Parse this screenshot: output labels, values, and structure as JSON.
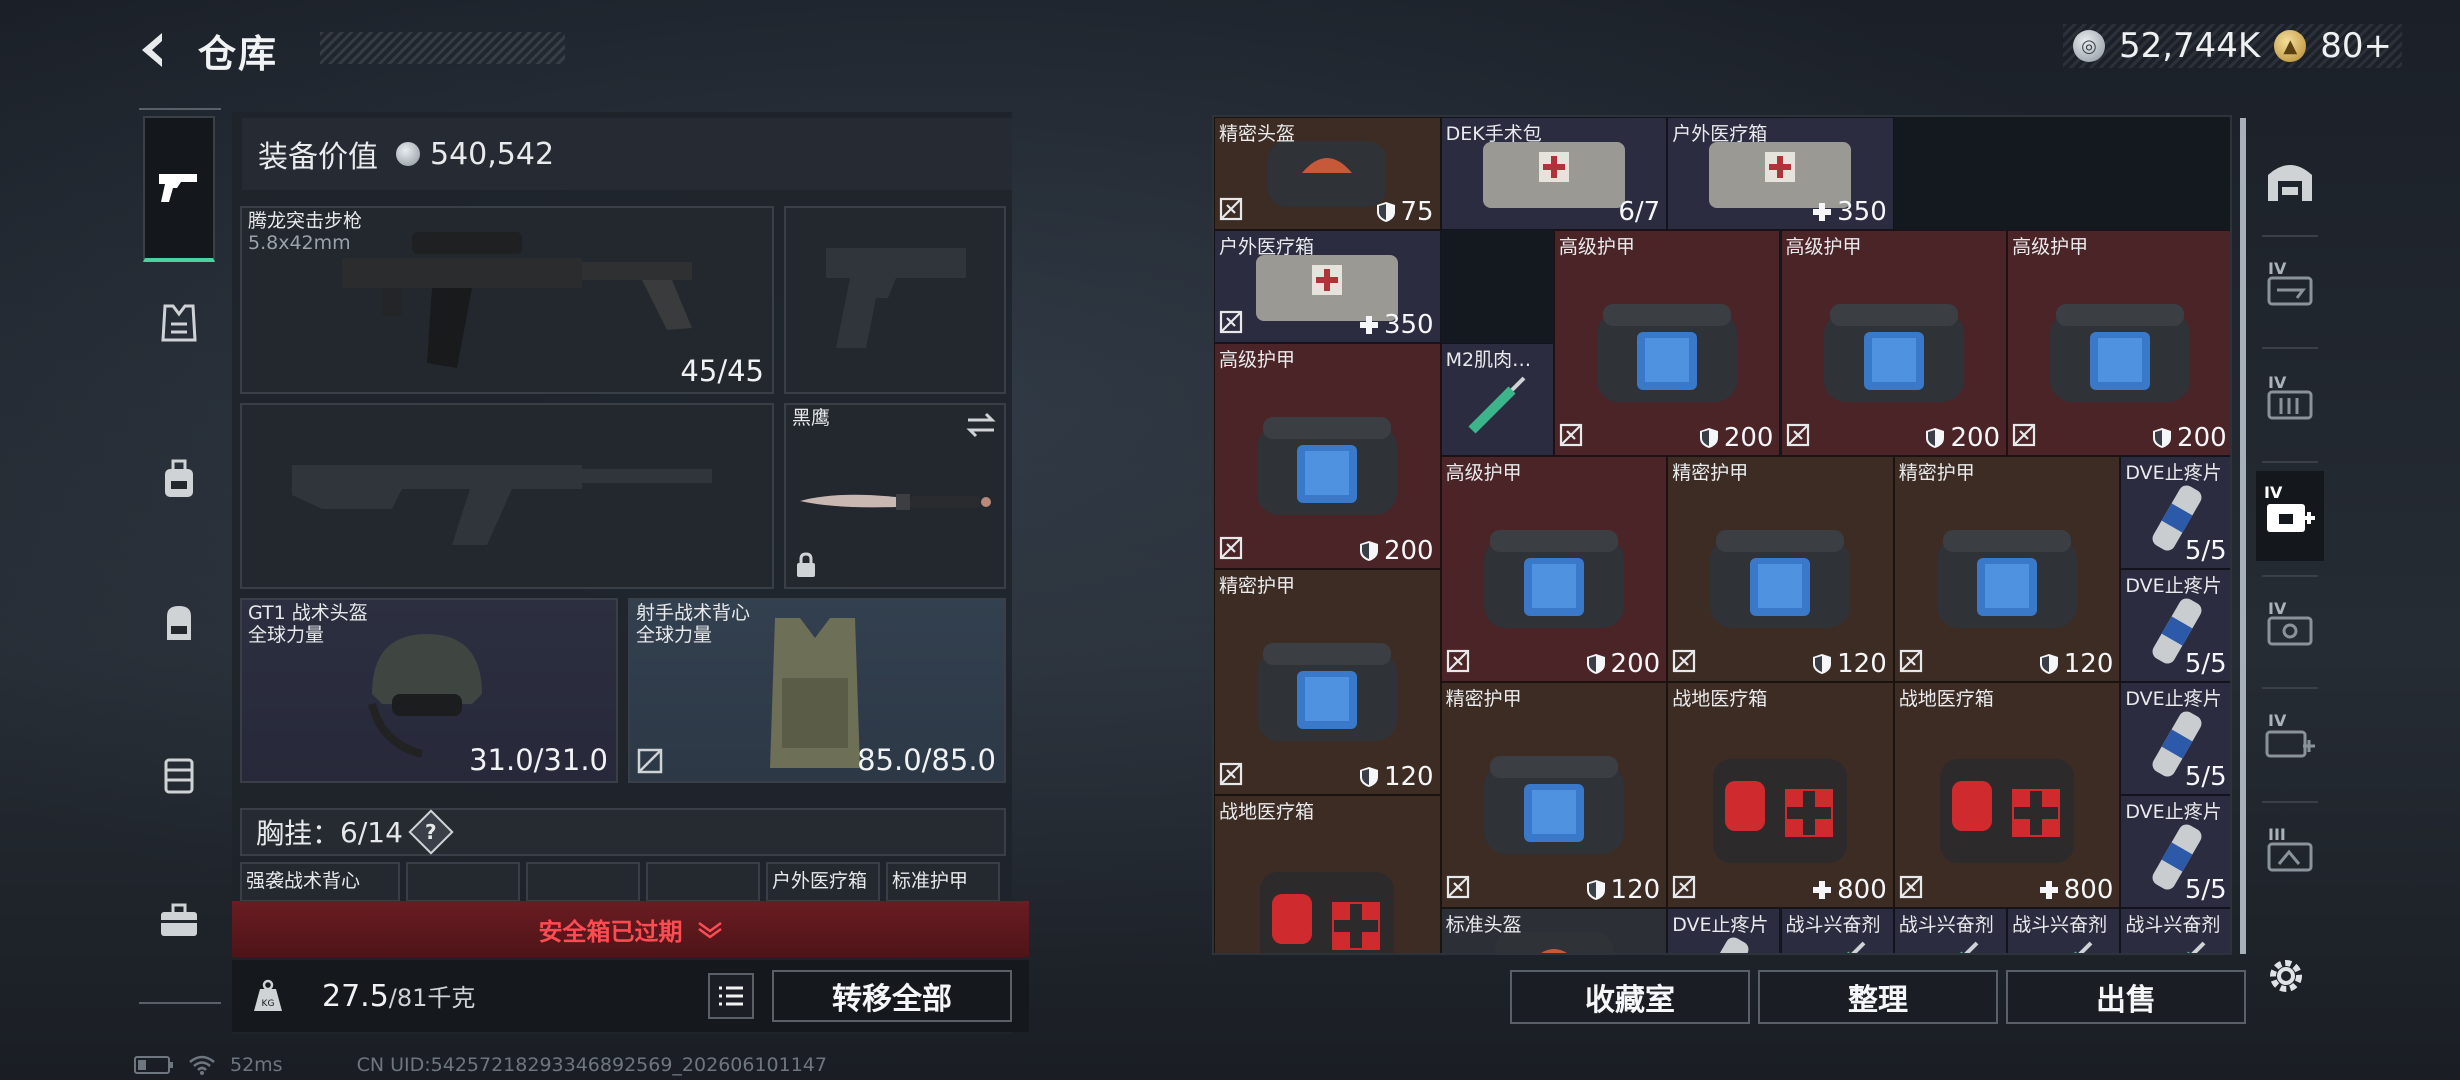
{
  "header": {
    "title": "仓库"
  },
  "currency": {
    "silver": "52,744K",
    "gold": "80+"
  },
  "equipment": {
    "value_label": "装备价值",
    "value": "540,542",
    "primary_weapon": {
      "name": "腾龙突击步枪",
      "caliber": "5.8x42mm",
      "ammo": "45/45"
    },
    "melee": {
      "name": "黑鹰"
    },
    "helmet": {
      "name": "GT1 战术头盔",
      "brand": "全球力量",
      "durability": "31.0/31.0"
    },
    "armor": {
      "name": "射手战术背心",
      "brand": "全球力量",
      "durability": "85.0/85.0"
    },
    "chest": {
      "label": "胸挂",
      "count": "6/14",
      "help": "?"
    },
    "chest_slots": [
      {
        "text": "强袭战术背心"
      },
      {
        "text": ""
      },
      {
        "text": ""
      },
      {
        "text": ""
      },
      {
        "text": "户外医疗箱"
      },
      {
        "text": "标准护甲"
      }
    ],
    "warning": "安全箱已过期",
    "weight": "27.5",
    "weight_max": "/81千克",
    "transfer_all": "转移全部"
  },
  "storage": {
    "items": [
      {
        "name": "精密头盔",
        "value": "75",
        "kind": "shield",
        "color": "brown",
        "lock": true
      },
      {
        "name": "DEK手术包",
        "value": "6/7",
        "kind": "count",
        "color": "navy",
        "lock": false
      },
      {
        "name": "户外医疗箱",
        "value": "350",
        "kind": "heal",
        "color": "navy",
        "lock": false
      },
      {
        "name": "户外医疗箱",
        "value": "350",
        "kind": "heal",
        "color": "navy",
        "lock": true
      },
      {
        "name": "高级护甲",
        "value": "200",
        "kind": "shield",
        "color": "red",
        "lock": true
      },
      {
        "name": "高级护甲",
        "value": "200",
        "kind": "shield",
        "color": "red",
        "lock": true
      },
      {
        "name": "高级护甲",
        "value": "200",
        "kind": "shield",
        "color": "red",
        "lock": true
      },
      {
        "name": "高级护甲",
        "value": "200",
        "kind": "shield",
        "color": "red",
        "lock": true
      },
      {
        "name": "M2肌肉…",
        "value": "",
        "kind": "none",
        "color": "navy",
        "lock": false
      },
      {
        "name": "高级护甲",
        "value": "200",
        "kind": "shield",
        "color": "red",
        "lock": true
      },
      {
        "name": "精密护甲",
        "value": "120",
        "kind": "shield",
        "color": "brown",
        "lock": true
      },
      {
        "name": "精密护甲",
        "value": "120",
        "kind": "shield",
        "color": "brown",
        "lock": true
      },
      {
        "name": "DVE止疼片",
        "value": "5/5",
        "kind": "count",
        "color": "navy",
        "lock": false
      },
      {
        "name": "精密护甲",
        "value": "120",
        "kind": "shield",
        "color": "brown",
        "lock": true
      },
      {
        "name": "DVE止疼片",
        "value": "5/5",
        "kind": "count",
        "color": "navy",
        "lock": false
      },
      {
        "name": "精密护甲",
        "value": "120",
        "kind": "shield",
        "color": "brown",
        "lock": true
      },
      {
        "name": "战地医疗箱",
        "value": "800",
        "kind": "heal",
        "color": "brown",
        "lock": true
      },
      {
        "name": "战地医疗箱",
        "value": "800",
        "kind": "heal",
        "color": "brown",
        "lock": true
      },
      {
        "name": "DVE止疼片",
        "value": "5/5",
        "kind": "count",
        "color": "navy",
        "lock": false
      },
      {
        "name": "DVE止疼片",
        "value": "5/5",
        "kind": "count",
        "color": "navy",
        "lock": false
      },
      {
        "name": "战地医疗箱",
        "value": "",
        "kind": "none",
        "color": "brown",
        "lock": false
      },
      {
        "name": "标准头盔",
        "value": "",
        "kind": "none",
        "color": "gray",
        "lock": false
      },
      {
        "name": "DVE止疼片",
        "value": "",
        "kind": "none",
        "color": "navy",
        "lock": false
      },
      {
        "name": "战斗兴奋剂",
        "value": "",
        "kind": "none",
        "color": "navy",
        "lock": false
      },
      {
        "name": "战斗兴奋剂",
        "value": "",
        "kind": "none",
        "color": "navy",
        "lock": false
      },
      {
        "name": "战斗兴奋剂",
        "value": "",
        "kind": "none",
        "color": "navy",
        "lock": false
      },
      {
        "name": "战斗兴奋剂",
        "value": "",
        "kind": "none",
        "color": "navy",
        "lock": false
      }
    ],
    "buttons": {
      "collection": "收藏室",
      "sort": "整理",
      "sell": "出售"
    }
  },
  "right_nav": {
    "tabs": [
      "IV",
      "IV",
      "IV",
      "IV",
      "IV",
      "III"
    ]
  },
  "status": {
    "ping": "52ms",
    "uid": "CN UID:54257218293346892569_202606101147"
  }
}
